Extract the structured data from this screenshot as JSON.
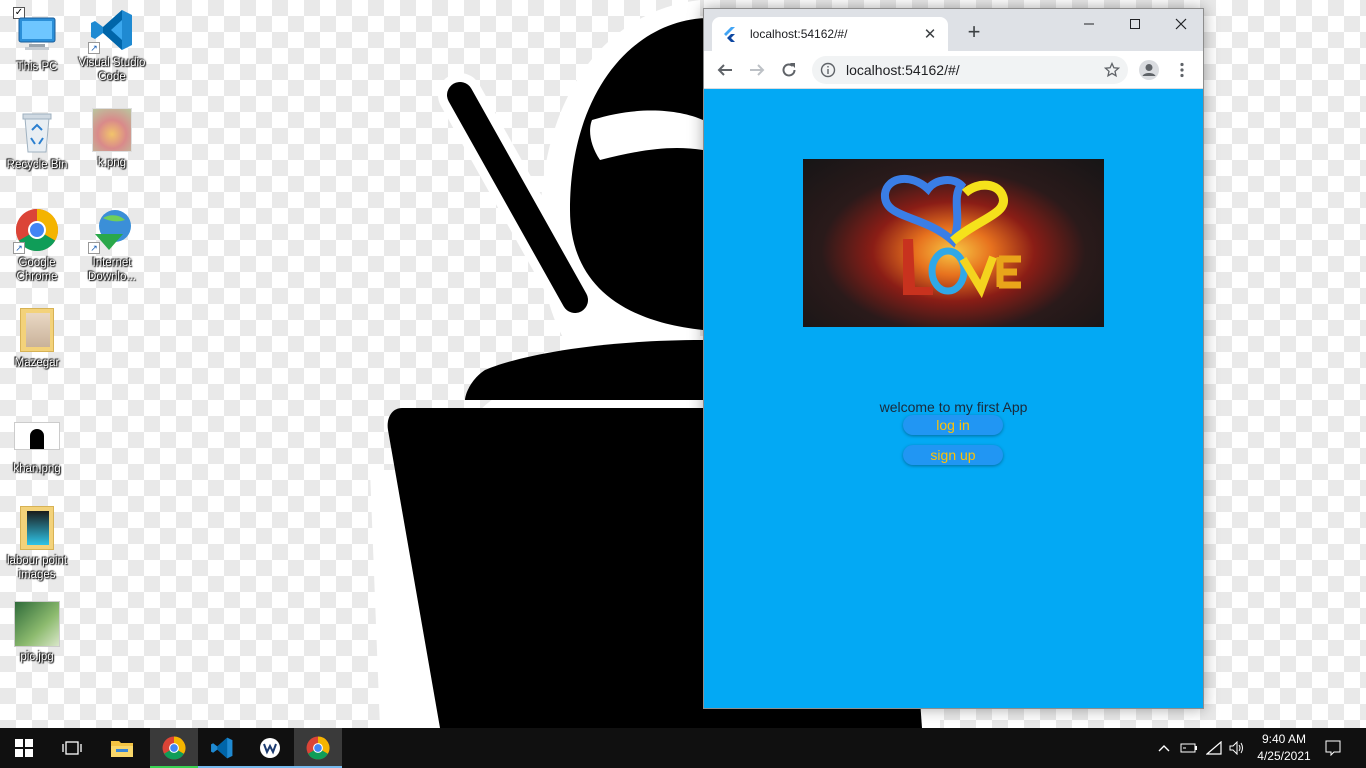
{
  "desktop": {
    "icons": [
      {
        "label": "This PC"
      },
      {
        "label": "Visual Studio Code"
      },
      {
        "label": "Recycle Bin"
      },
      {
        "label": "k.png"
      },
      {
        "label": "Google Chrome"
      },
      {
        "label": "Internet Downlo..."
      },
      {
        "label": "Mazegar"
      },
      {
        "label": "khan.png"
      },
      {
        "label": "labour point images"
      },
      {
        "label": "pic.jpg"
      }
    ]
  },
  "browser": {
    "tab_title": "localhost:54162/#/",
    "url": "localhost:54162/#/",
    "new_tab_symbol": "+",
    "tab_close_symbol": "✕"
  },
  "app": {
    "welcome_text": "welcome to my first App",
    "login_label": "log in",
    "signup_label": "sign up",
    "background_color": "#03a9f4",
    "button_color": "#2196f3",
    "button_text_color": "#ffc107"
  },
  "taskbar": {
    "time": "9:40 AM",
    "date": "4/25/2021"
  }
}
